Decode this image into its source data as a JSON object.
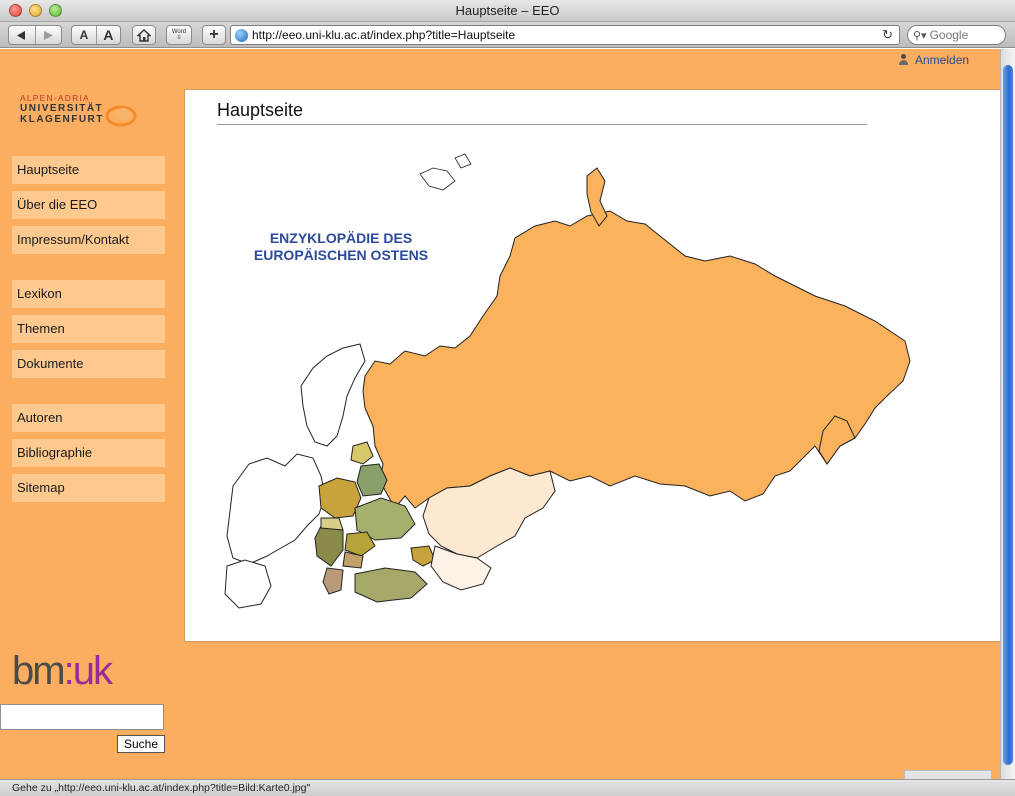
{
  "window": {
    "title": "Hauptseite – EEO"
  },
  "toolbar": {
    "url": "http://eeo.uni-klu.ac.at/index.php?title=Hauptseite",
    "search_placeholder": "Google",
    "zoom_small": "A",
    "zoom_large": "A",
    "word_label": "Word"
  },
  "header": {
    "login_label": "Anmelden"
  },
  "logo": {
    "line1": "ALPEN-ADRIA",
    "line2": "UNIVERSITÄT",
    "line3": "KLAGENFURT"
  },
  "sidebar": {
    "items": [
      {
        "label": "Hauptseite"
      },
      {
        "label": "Über die EEO"
      },
      {
        "label": "Impressum/Kontakt"
      },
      {
        "label": "Lexikon"
      },
      {
        "label": "Themen"
      },
      {
        "label": "Dokumente"
      },
      {
        "label": "Autoren"
      },
      {
        "label": "Bibliographie"
      },
      {
        "label": "Sitemap"
      }
    ],
    "sponsor": {
      "text_a": "bm",
      "text_b": ":uk"
    },
    "search": {
      "value": "",
      "button_label": "Suche"
    }
  },
  "main": {
    "title": "Hauptseite",
    "map_title_line1": "ENZYKLOPÄDIE DES",
    "map_title_line2": "EUROPÄISCHEN OSTENS"
  },
  "status": {
    "text": "Gehe zu „http://eeo.uni-klu.ac.at/index.php?title=Bild:Karte0.jpg\""
  },
  "colors": {
    "page_bg": "#fbae60",
    "sidebar_item_bg": "#fdc98f",
    "russia_fill": "#fbb25c",
    "link_blue": "#2b4a9a"
  }
}
